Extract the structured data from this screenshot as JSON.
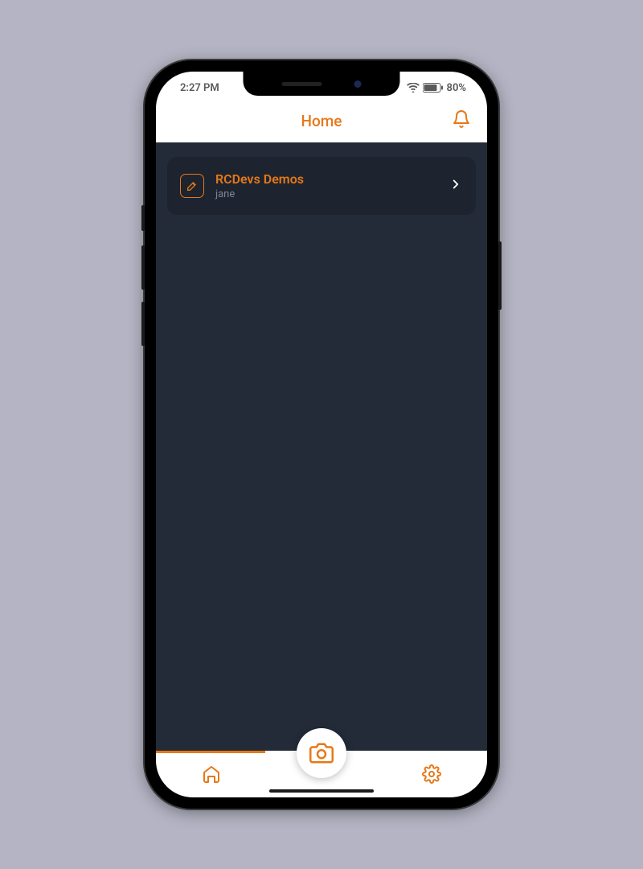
{
  "statusbar": {
    "time": "2:27 PM",
    "battery": "80%"
  },
  "header": {
    "title": "Home"
  },
  "accounts": [
    {
      "title": "RCDevs Demos",
      "subtitle": "jane"
    }
  ],
  "colors": {
    "accent": "#e77817",
    "bg_dark": "#232b38",
    "card_bg": "#1d2430"
  }
}
